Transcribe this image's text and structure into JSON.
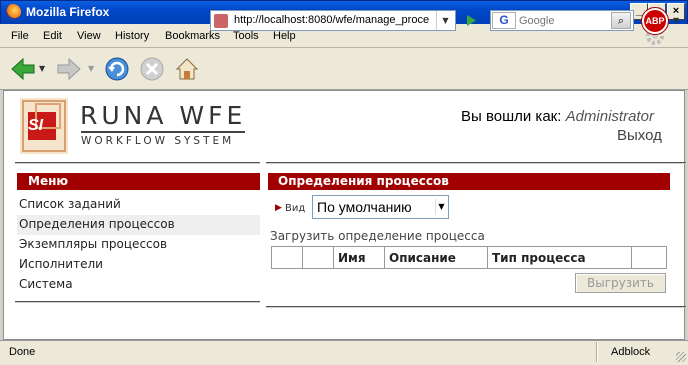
{
  "window": {
    "title": "Mozilla Firefox"
  },
  "menubar": [
    "File",
    "Edit",
    "View",
    "History",
    "Bookmarks",
    "Tools",
    "Help"
  ],
  "navbar": {
    "url": "http://localhost:8080/wfe/manage_proce",
    "search_engine": "G",
    "search_placeholder": "Google",
    "abp_label": "ABP"
  },
  "header": {
    "logo_title": "RUNA WFE",
    "logo_subtitle": "WORKFLOW SYSTEM",
    "logo_badge": "SI",
    "login_prefix": "Вы вошли как:",
    "login_user": "Administrator",
    "logout": "Выход"
  },
  "sidebar": {
    "title": "Меню",
    "items": [
      {
        "label": "Список заданий",
        "active": false
      },
      {
        "label": "Определения процессов",
        "active": true
      },
      {
        "label": "Экземпляры процессов",
        "active": false
      },
      {
        "label": "Исполнители",
        "active": false
      },
      {
        "label": "Система",
        "active": false
      }
    ]
  },
  "main": {
    "title": "Определения процессов",
    "view_label": "Вид",
    "view_value": "По умолчанию",
    "upload_link": "Загрузить определение процесса",
    "table_headers": [
      "",
      "",
      "Имя",
      "Описание",
      "Тип процесса",
      ""
    ],
    "export_button": "Выгрузить"
  },
  "status": {
    "text": "Done",
    "adblock": "Adblock"
  },
  "colors": {
    "accent": "#a00000",
    "titlebar": "#0047c8"
  }
}
